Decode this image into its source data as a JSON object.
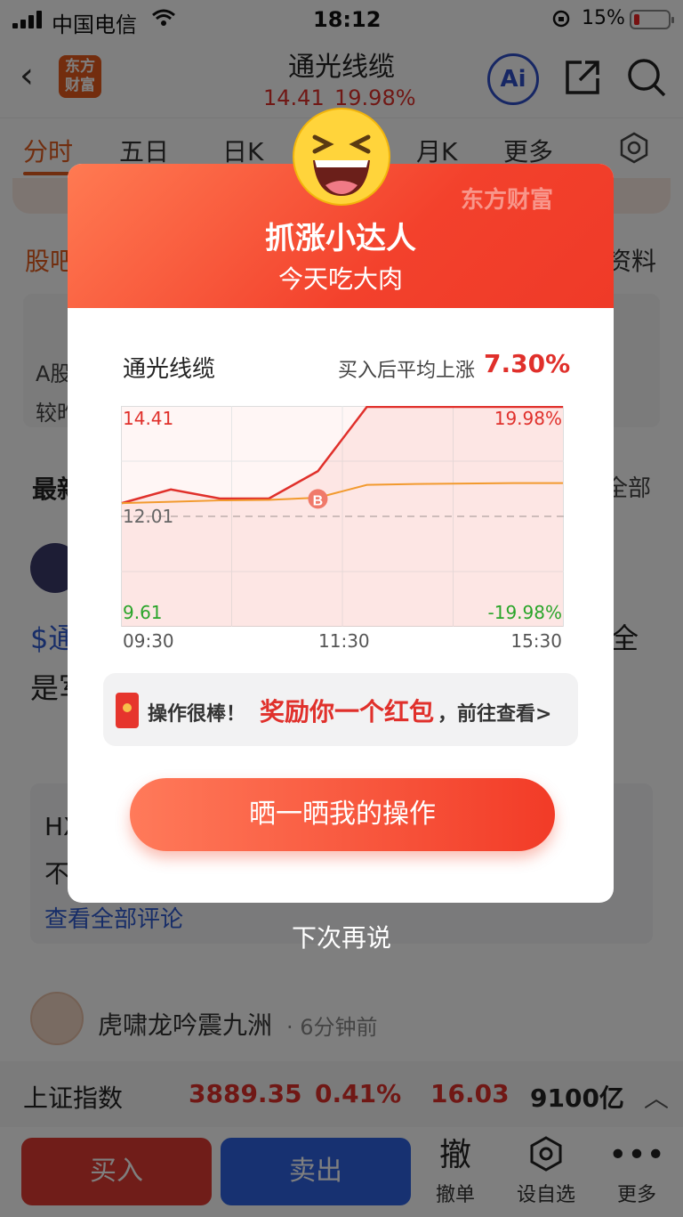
{
  "status_bar": {
    "carrier": "中国电信",
    "time": "18:12",
    "battery": "15%"
  },
  "nav": {
    "title": "通光线缆",
    "price": "14.41",
    "change_pct": "19.98%",
    "logo": "东方\n财富",
    "ai": "Ai"
  },
  "tabs": [
    {
      "label": "分时"
    },
    {
      "label": "五日"
    },
    {
      "label": "日K"
    },
    {
      "label": "月K"
    },
    {
      "label": "更多"
    }
  ],
  "background": {
    "section_tab_left": "股吧",
    "section_tab_right": "资料",
    "card_line1": "A股",
    "card_line2": "较昨",
    "latest": "最新",
    "all": "全部",
    "post_line1": "$通",
    "post_tail": "全",
    "post_line2": "是军",
    "quote_line1": "HX",
    "quote_line2": "不",
    "comment_link": "查看全部评论",
    "user_name": "虎啸龙吟震九洲",
    "post_time": "· 6分钟前"
  },
  "ticker": {
    "name": "上证指数",
    "value": "3889.35",
    "pct": "0.41%",
    "change": "16.03",
    "volume": "9100亿"
  },
  "actions": {
    "buy": "买入",
    "sell": "卖出",
    "cancel_icon": "撤",
    "cancel": "撤单",
    "watch": "设自选",
    "more": "更多"
  },
  "modal": {
    "brand": "东方财富",
    "title": "抓涨小达人",
    "subtitle": "今天吃大肉",
    "stock": "通光线缆",
    "avg_label": "买入后平均上涨",
    "avg_value": "7.30%",
    "chart": {
      "y_top": "14.41",
      "y_mid": "12.01",
      "y_bot": "9.61",
      "pct_top": "19.98%",
      "pct_bot": "-19.98%",
      "times": [
        "09:30",
        "11:30",
        "15:30"
      ],
      "buy_marker": "B"
    },
    "reward_prefix": "操作很棒！",
    "reward_highlight": "奖励你一个红包",
    "reward_suffix": "，前往查看>",
    "cta": "晒一晒我的操作",
    "later": "下次再说"
  },
  "chart_data": {
    "type": "line",
    "x": [
      "09:30",
      "10:00",
      "10:30",
      "11:00",
      "11:30",
      "13:30",
      "14:00",
      "14:30",
      "15:00",
      "15:30"
    ],
    "ylim": [
      9.61,
      14.41
    ],
    "reference": 12.01,
    "series": [
      {
        "values": [
          12.3,
          12.6,
          12.4,
          12.4,
          13.0,
          14.41,
          14.41,
          14.41,
          14.41,
          14.41
        ]
      },
      {
        "values": [
          12.3,
          12.33,
          12.36,
          12.37,
          12.42,
          12.7,
          12.72,
          12.73,
          12.74,
          12.74
        ]
      }
    ],
    "buy_point": {
      "x": "11:30",
      "y": 12.9
    }
  }
}
